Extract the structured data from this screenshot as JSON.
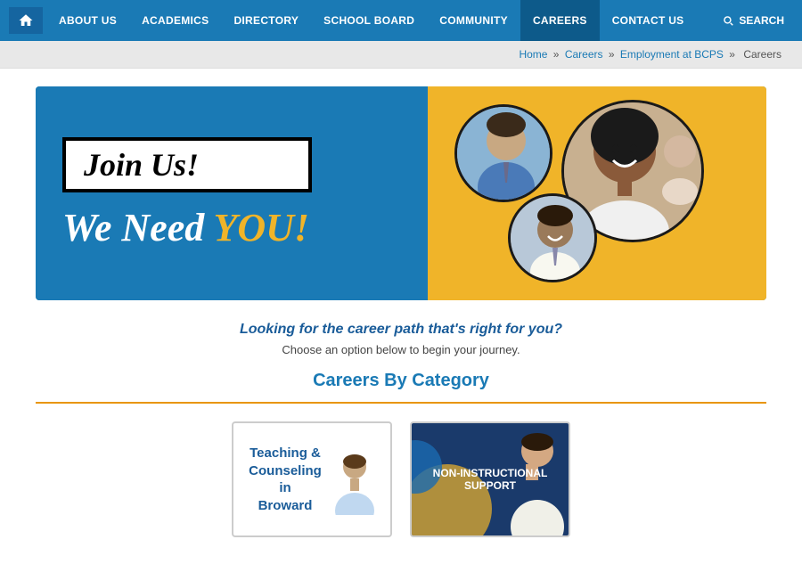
{
  "nav": {
    "items": [
      {
        "id": "about-us",
        "label": "ABOUT US",
        "active": false
      },
      {
        "id": "academics",
        "label": "ACADEMICS",
        "active": false
      },
      {
        "id": "directory",
        "label": "DIRECTORY",
        "active": false
      },
      {
        "id": "school-board",
        "label": "SCHOOL BOARD",
        "active": false
      },
      {
        "id": "community",
        "label": "COMMUNITY",
        "active": false
      },
      {
        "id": "careers",
        "label": "CAREERS",
        "active": true
      },
      {
        "id": "contact-us",
        "label": "CONTACT US",
        "active": false
      }
    ],
    "search_label": "SEARCH"
  },
  "breadcrumb": {
    "home": "Home",
    "sep1": "»",
    "careers": "Careers",
    "sep2": "»",
    "employment": "Employment at BCPS",
    "sep3": "»",
    "current": "Careers"
  },
  "hero": {
    "join_us": "Join Us!",
    "we_need": "We Need ",
    "you": "YOU!"
  },
  "section": {
    "looking_text": "Looking for the career path that's right for you?",
    "choose_text": "Choose an option below to begin your journey.",
    "careers_category_title": "Careers By Category"
  },
  "cards": [
    {
      "id": "teaching-counseling",
      "title": "Teaching &\nCounseling\nin\nBroward"
    },
    {
      "id": "non-instructional",
      "title": "NON-INSTRUCTIONAL\nSUPPORT"
    }
  ]
}
